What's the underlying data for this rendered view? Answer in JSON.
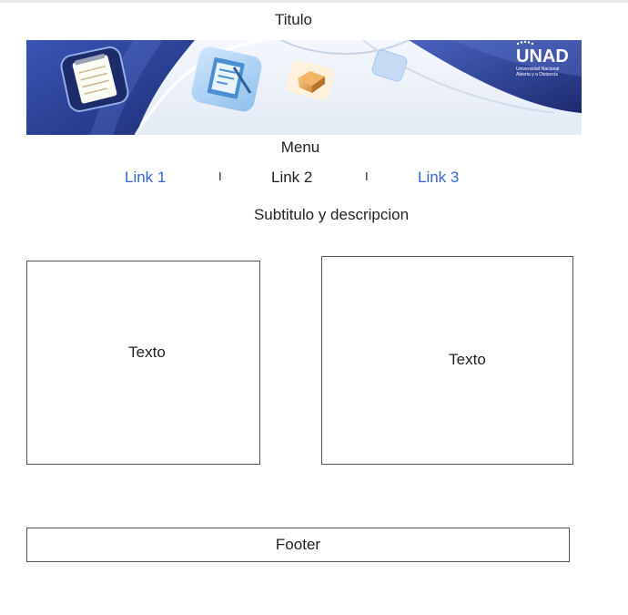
{
  "page": {
    "title": "Titulo",
    "menu_title": "Menu",
    "subtitle": "Subtitulo y descripcion"
  },
  "banner": {
    "logo_text": "UNAD",
    "logo_subtext_line1": "Universidad Nacional",
    "logo_subtext_line2": "Abierta y a Distancia"
  },
  "nav": {
    "links": [
      {
        "label": "Link 1",
        "active": false
      },
      {
        "label": "Link 2",
        "active": true
      },
      {
        "label": "Link 3",
        "active": false
      }
    ],
    "separator": "I"
  },
  "content": {
    "box_left_text": "Texto",
    "box_right_text": "Texto"
  },
  "footer": {
    "text": "Footer"
  },
  "colors": {
    "link": "#3366dd",
    "banner_blue": "#2d3f8f",
    "banner_light": "#dfe7f3"
  }
}
